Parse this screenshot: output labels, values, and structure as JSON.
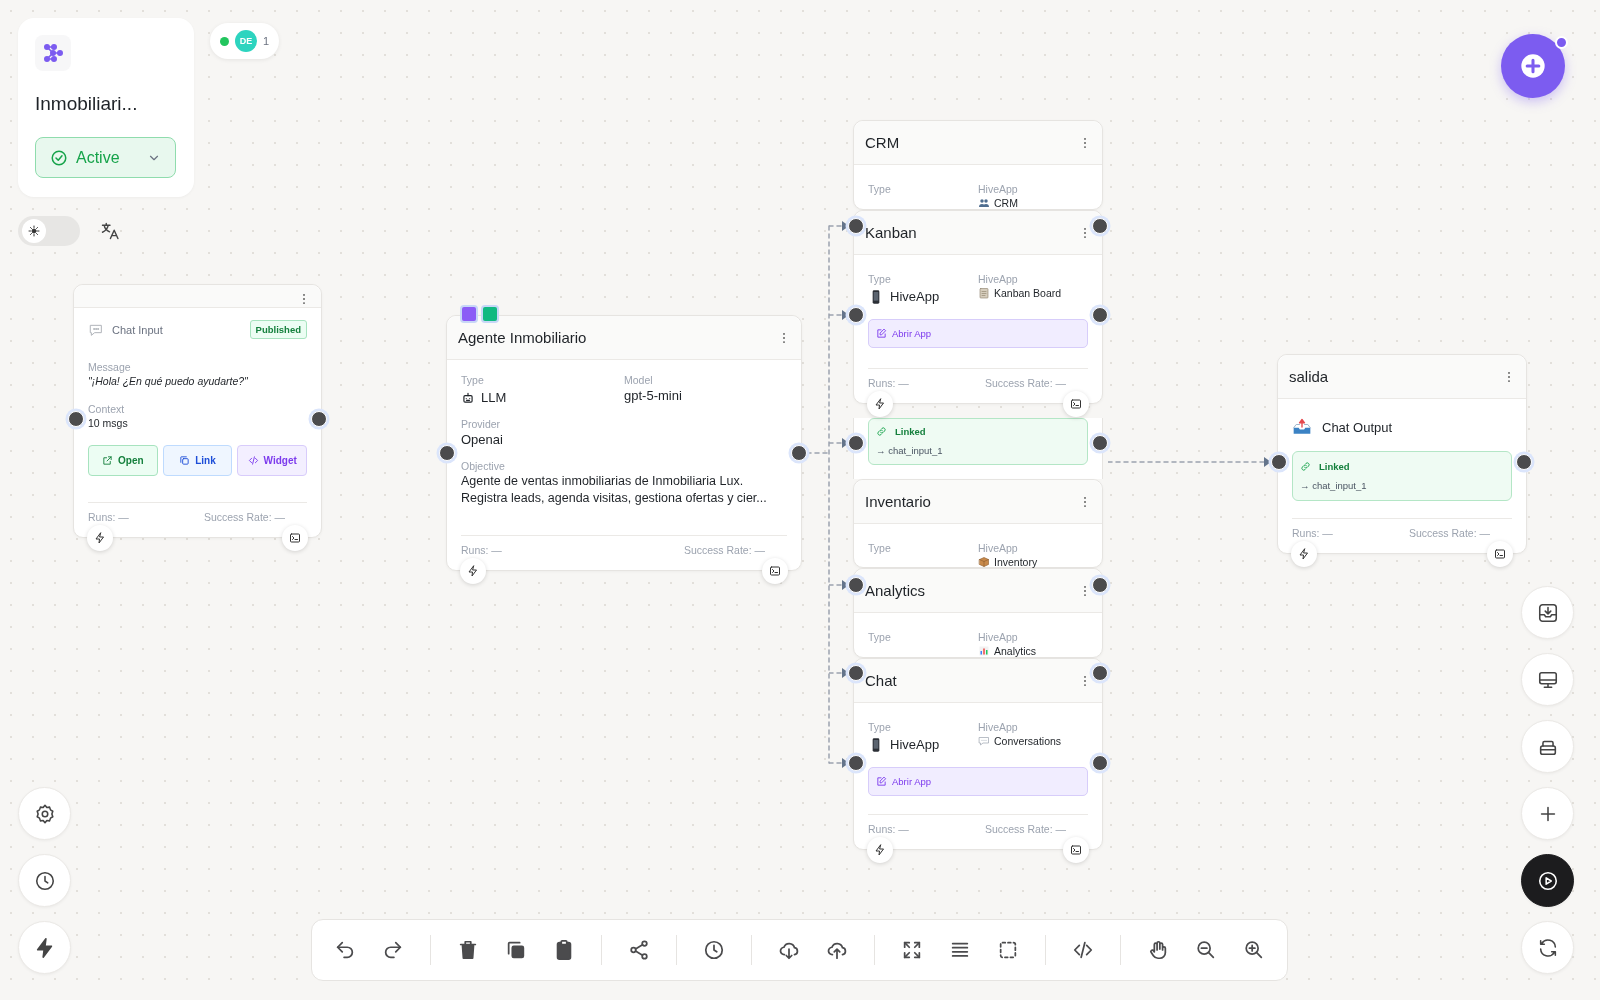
{
  "workflow": {
    "title": "Inmobiliari...",
    "status": {
      "label": "Active",
      "kind": "active"
    }
  },
  "presence": {
    "online": true,
    "avatar": "DE",
    "count": "1"
  },
  "dark_mode": false,
  "nodes": [
    {
      "kind": "chat_input",
      "label": "Chat Input",
      "badge": "Published",
      "fields": [
        {
          "label": "Message",
          "value": "\"¡Hola! ¿En qué puedo ayudarte?\"",
          "italic": true
        },
        {
          "label": "Context",
          "value": "10 msgs",
          "italic": false
        }
      ],
      "actions": [
        {
          "kind": "open",
          "label": "Open"
        },
        {
          "kind": "link",
          "label": "Link"
        },
        {
          "kind": "widget",
          "label": "Widget"
        }
      ],
      "stats": {
        "runs": "Runs: —",
        "success": "Success Rate: —"
      }
    },
    {
      "kind": "agent",
      "title": "Agente Inmobiliario",
      "tags": [
        {
          "color": "#8b5cf6"
        },
        {
          "color": "#10b981"
        }
      ],
      "type": {
        "label": "Type",
        "value": "LLM"
      },
      "model": {
        "label": "Model",
        "value": "gpt-5-mini"
      },
      "provider": {
        "label": "Provider",
        "value": "Openai"
      },
      "objective": {
        "label": "Objective",
        "value": "Agente de ventas inmobiliarias de Inmobiliaria Lux. Registra leads, agenda visitas, gestiona ofertas y cier..."
      },
      "stats": {
        "runs": "Runs: —",
        "success": "Success Rate: —"
      }
    },
    {
      "kind": "hiveapp",
      "title": "CRM",
      "type": {
        "label": "Type"
      },
      "app": {
        "label": "HiveApp",
        "kind": "contacts",
        "name": "CRM"
      },
      "linked": {
        "label": "Linked",
        "target": "→ chat_input_1"
      }
    },
    {
      "kind": "hiveapp",
      "title": "Kanban",
      "type": {
        "label": "Type",
        "value": "HiveApp"
      },
      "app": {
        "label": "HiveApp",
        "kind": "board",
        "name": "Kanban Board"
      },
      "open_button": "Abrir App",
      "stats": {
        "runs": "Runs: —",
        "success": "Success Rate: —"
      }
    },
    {
      "kind": "hiveapp",
      "title": "Inventario",
      "type": {
        "label": "Type"
      },
      "app": {
        "label": "HiveApp",
        "kind": "package",
        "name": "Inventory"
      }
    },
    {
      "kind": "hiveapp",
      "title": "Analytics",
      "type": {
        "label": "Type"
      },
      "app": {
        "label": "HiveApp",
        "kind": "chart",
        "name": "Analytics"
      }
    },
    {
      "kind": "hiveapp",
      "title": "Chat",
      "type": {
        "label": "Type",
        "value": "HiveApp"
      },
      "app": {
        "label": "HiveApp",
        "kind": "conversation",
        "name": "Conversations"
      },
      "open_button": "Abrir App",
      "stats": {
        "runs": "Runs: —",
        "success": "Success Rate: —"
      }
    },
    {
      "kind": "output",
      "title": "salida",
      "label": "Chat Output",
      "linked": {
        "label": "Linked",
        "target": "→ chat_input_1"
      },
      "stats": {
        "runs": "Runs: —",
        "success": "Success Rate: —"
      }
    }
  ]
}
